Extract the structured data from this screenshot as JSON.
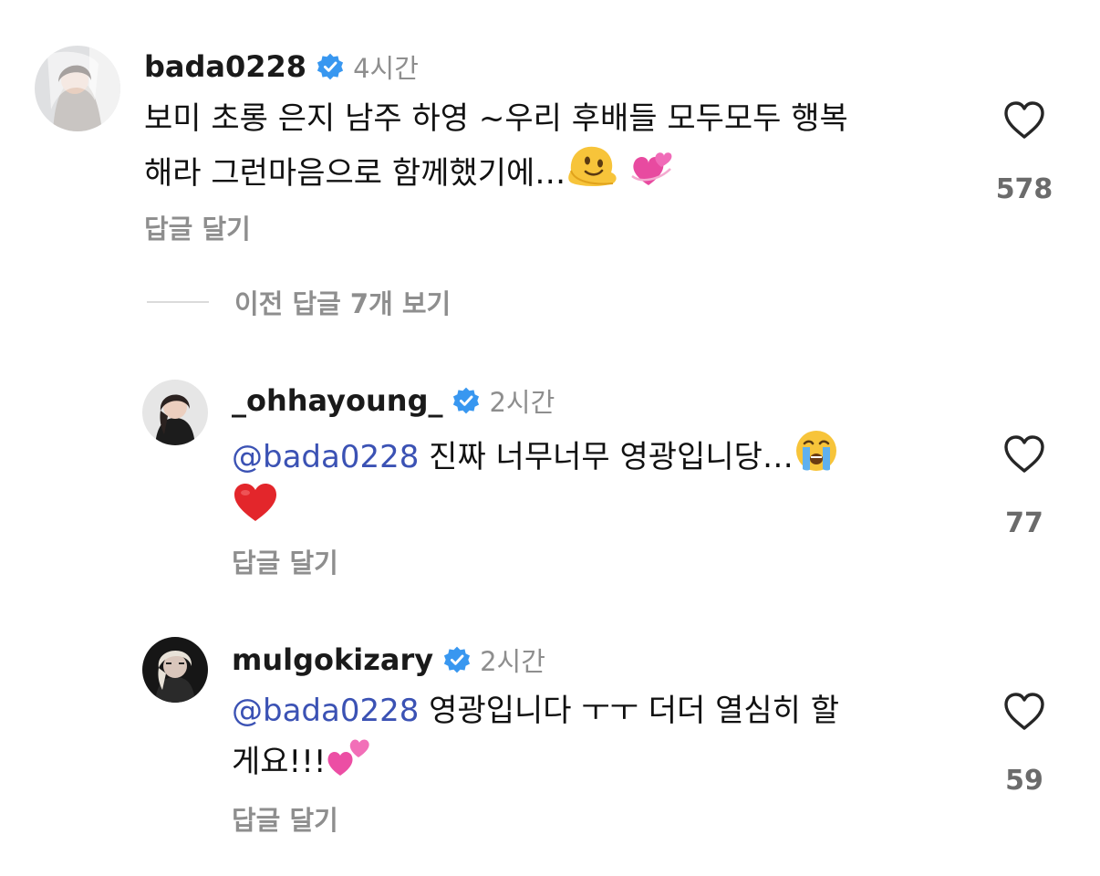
{
  "comments": [
    {
      "username": "bada0228",
      "time": "4시간",
      "text_lines": [
        "보미 초롱 은지 남주 하영 ~우리 후배들 모두모두 행복",
        "해라  그런마음으로 함께했기에…"
      ],
      "emojis": [
        "melting-face",
        "two-hearts-circling"
      ],
      "reply_label": "답글 달기",
      "likes": "578",
      "verified": true
    }
  ],
  "view_previous": "이전 답글 7개 보기",
  "replies": [
    {
      "username": "_ohhayoung_",
      "time": "2시간",
      "mention": "@bada0228",
      "text": " 진짜 너무너무 영광입니당…",
      "emojis": [
        "loudly-crying-face",
        "red-heart"
      ],
      "reply_label": "답글 달기",
      "likes": "77",
      "verified": true
    },
    {
      "username": "mulgokizary",
      "time": "2시간",
      "mention": "@bada0228",
      "text_line1": " 영광입니다 ㅜㅜ 더더 열심히 할",
      "text_line2": "게요!!!",
      "emojis": [
        "two-hearts"
      ],
      "reply_label": "답글 달기",
      "likes": "59",
      "verified": true
    }
  ],
  "colors": {
    "mention": "#3b52b4",
    "verified": "#3897f0",
    "muted": "#8e8e8e"
  }
}
